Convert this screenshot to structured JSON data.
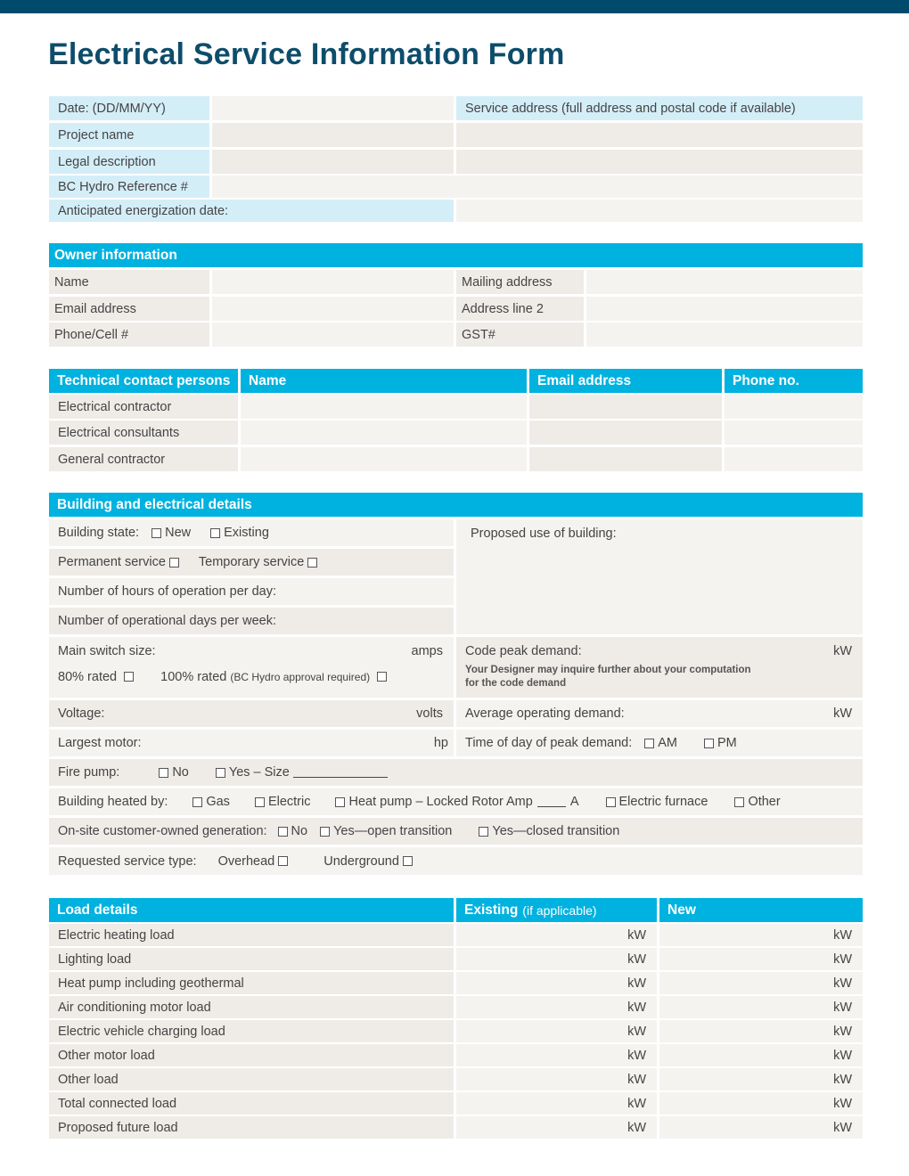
{
  "header": {
    "title": "Electrical Service Information Form"
  },
  "general": {
    "date_label": "Date: (DD/MM/YY)",
    "project_name_label": "Project name",
    "legal_description_label": "Legal description",
    "reference_label": "BC Hydro Reference #",
    "energization_label": "Anticipated energization date:",
    "service_address_label": "Service address (full address and postal code if available)"
  },
  "owner": {
    "heading": "Owner information",
    "name_label": "Name",
    "email_label": "Email address",
    "phone_label": "Phone/Cell #",
    "mailing_label": "Mailing address",
    "address2_label": "Address line 2",
    "gst_label": "GST#"
  },
  "technical": {
    "headers": [
      "Technical contact persons",
      "Name",
      "Email address",
      "Phone no."
    ],
    "rows": [
      "Electrical contractor",
      "Electrical consultants",
      "General contractor"
    ]
  },
  "building": {
    "heading": "Building and electrical details",
    "state_label": "Building state:",
    "state_new": "New",
    "state_existing": "Existing",
    "permanent": "Permanent service",
    "temporary": "Temporary service",
    "hours_label": "Number of hours of operation per day:",
    "days_label": "Number of operational days per week:",
    "proposed_use_label": "Proposed use of building:",
    "main_switch_label": "Main switch size:",
    "main_switch_unit": "amps",
    "rated80": "80% rated",
    "rated100": "100% rated",
    "rated100_note": "(BC Hydro approval required)",
    "code_peak_label": "Code peak demand:",
    "code_peak_unit": "kW",
    "code_peak_note_1": "Your Designer may inquire further about your computation",
    "code_peak_note_2": "for the code demand",
    "voltage_label": "Voltage:",
    "voltage_unit": "volts",
    "avg_demand_label": "Average operating demand:",
    "avg_demand_unit": "kW",
    "motor_label": "Largest motor:",
    "motor_unit": "hp",
    "peak_time_label": "Time of day of peak demand:",
    "am": "AM",
    "pm": "PM",
    "fire_pump_label": "Fire pump:",
    "fire_no": "No",
    "fire_yes": "Yes – Size",
    "heated_label": "Building heated by:",
    "heat_gas": "Gas",
    "heat_electric": "Electric",
    "heat_pump": "Heat pump – Locked Rotor Amp",
    "heat_pump_unit": "A",
    "heat_furnace": "Electric furnace",
    "heat_other": "Other",
    "generation_label": "On-site customer-owned generation:",
    "gen_no": "No",
    "gen_open": "Yes—open transition",
    "gen_closed": "Yes—closed transition",
    "service_type_label": "Requested service type:",
    "overhead": "Overhead",
    "underground": "Underground"
  },
  "load": {
    "heading": "Load details",
    "existing_heading": "Existing",
    "existing_note": "(if applicable)",
    "new_heading": "New",
    "unit": "kW",
    "rows": [
      "Electric heating load",
      "Lighting load",
      "Heat pump including geothermal",
      "Air conditioning motor load",
      "Electric vehicle charging load",
      "Other motor load",
      "Other load",
      "Total connected load",
      "Proposed future load"
    ]
  }
}
